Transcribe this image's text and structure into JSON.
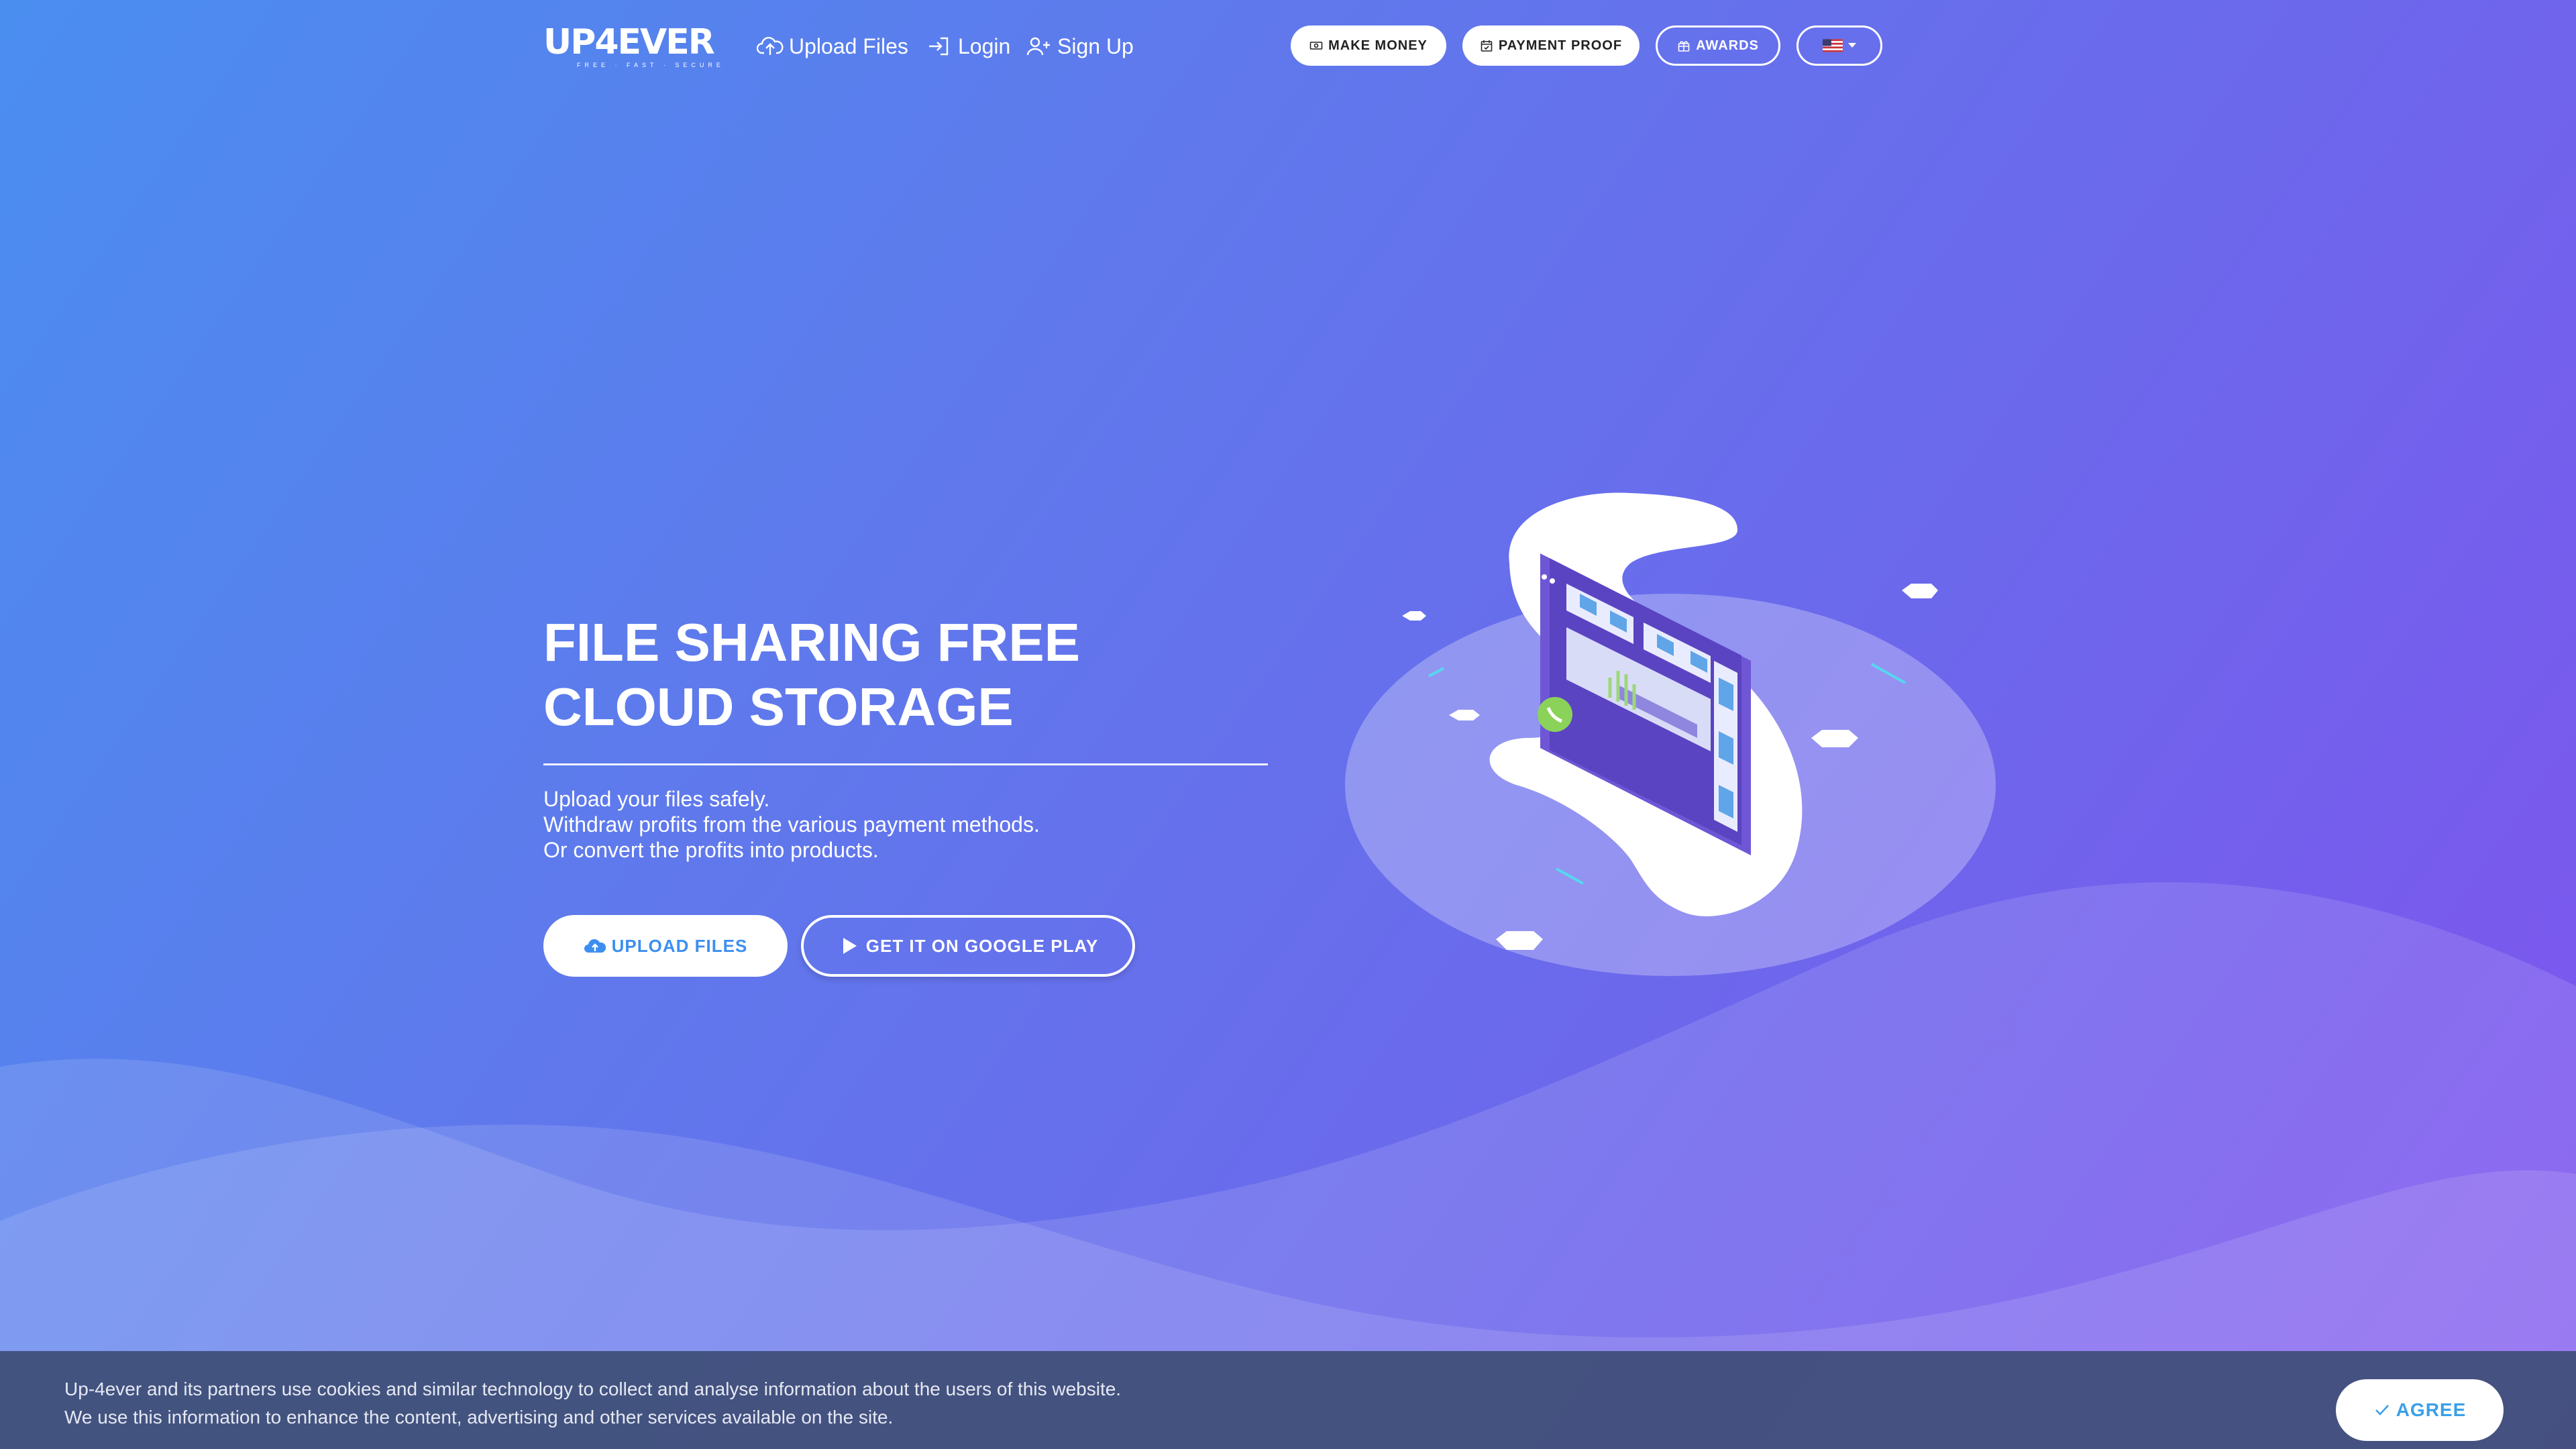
{
  "brand": {
    "logo": "UP4EVER",
    "tagline": "FREE · FAST · SECURE"
  },
  "nav": {
    "upload": "Upload Files",
    "login": "Login",
    "signup": "Sign Up",
    "make_money": "MAKE MONEY",
    "payment_proof": "PAYMENT PROOF",
    "awards": "AWARDS",
    "language_icon": "us-flag-icon"
  },
  "hero": {
    "title": "FILE SHARING FREE CLOUD STORAGE",
    "lines": [
      "Upload your files safely.",
      "Withdraw profits from the various payment methods.",
      "Or convert the profits into products."
    ],
    "upload_button": "UPLOAD FILES",
    "play_button": "GET IT ON GOOGLE PLAY"
  },
  "cookie": {
    "line1": "Up-4ever and its partners use cookies and similar technology to collect and analyse information about the users of this website.",
    "line2": "We use this information to enhance the content, advertising and other services available on the site.",
    "agree": "AGREE"
  },
  "colors": {
    "gradient_start": "#4a8ef0",
    "gradient_end": "#7f53ee",
    "button_text": "#3c8ff0",
    "cookie_bar": "#3e4d76"
  }
}
